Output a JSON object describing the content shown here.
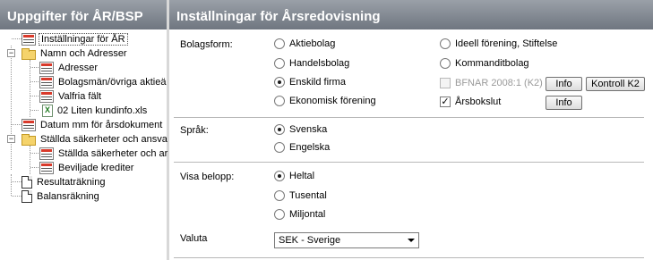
{
  "left_header": "Uppgifter för ÅR/BSP",
  "right_header": "Inställningar för Årsredovisning",
  "tree": {
    "items": [
      {
        "label": "Inställningar för ÅR"
      },
      {
        "label": "Namn och Adresser"
      },
      {
        "label": "Adresser"
      },
      {
        "label": "Bolagsmän/övriga aktieä"
      },
      {
        "label": "Valfria fält"
      },
      {
        "label": "02 Liten kundinfo.xls"
      },
      {
        "label": "Datum mm för årsdokument"
      },
      {
        "label": "Ställda säkerheter och ansva"
      },
      {
        "label": "Ställda säkerheter och ar"
      },
      {
        "label": "Beviljade krediter"
      },
      {
        "label": "Resultaträkning"
      },
      {
        "label": "Balansräkning"
      }
    ]
  },
  "bolagsform": {
    "label": "Bolagsform:",
    "options": [
      "Aktiebolag",
      "Handelsbolag",
      "Enskild firma",
      "Ekonomisk förening",
      "Ideell förening, Stiftelse",
      "Kommanditbolag"
    ],
    "selected": "Enskild firma",
    "bfnar_label": "BFNAR 2008:1 (K2)",
    "bfnar_checked": false,
    "arsbokslut_label": "Årsbokslut",
    "arsbokslut_checked": true,
    "info_label": "Info",
    "kontroll_label": "Kontroll K2",
    "info2_label": "Info"
  },
  "sprak": {
    "label": "Språk:",
    "options": [
      "Svenska",
      "Engelska"
    ],
    "selected": "Svenska"
  },
  "visa_belopp": {
    "label": "Visa belopp:",
    "options": [
      "Heltal",
      "Tusental",
      "Miljontal"
    ],
    "selected": "Heltal"
  },
  "valuta": {
    "label": "Valuta",
    "value": "SEK - Sverige"
  }
}
